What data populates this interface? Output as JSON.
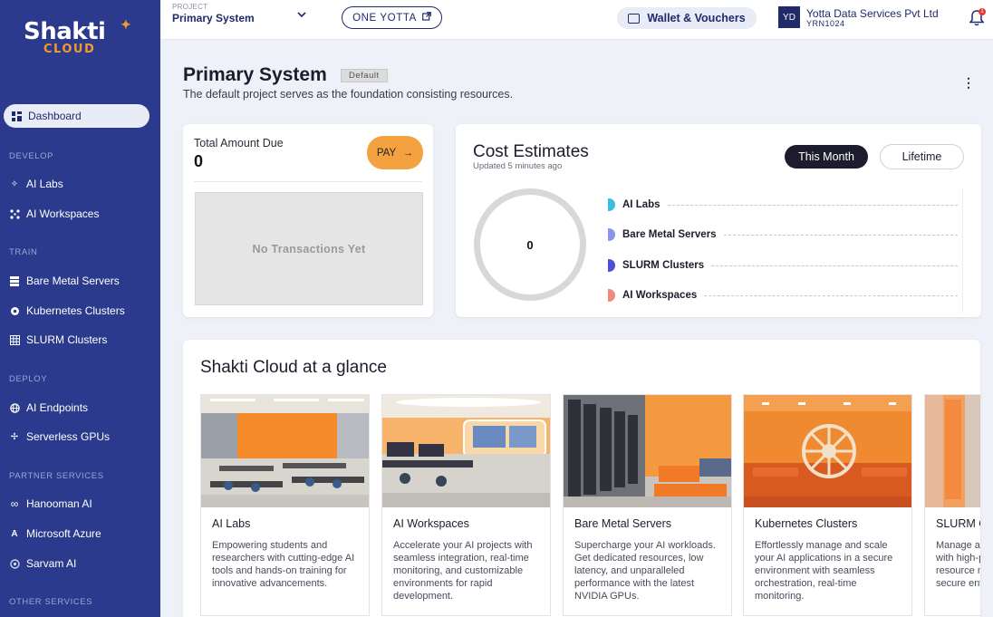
{
  "brand": {
    "name": "Shakti",
    "sub": "CLOUD"
  },
  "sidebar": {
    "active": {
      "label": "Dashboard"
    },
    "sections": [
      {
        "title": "DEVELOP",
        "items": [
          {
            "label": "AI Labs",
            "icon": "sparkle-icon"
          },
          {
            "label": "AI Workspaces",
            "icon": "nodes-icon"
          }
        ]
      },
      {
        "title": "TRAIN",
        "items": [
          {
            "label": "Bare Metal Servers",
            "icon": "server-icon"
          },
          {
            "label": "Kubernetes Clusters",
            "icon": "helm-icon"
          },
          {
            "label": "SLURM Clusters",
            "icon": "grid-icon"
          }
        ]
      },
      {
        "title": "DEPLOY",
        "items": [
          {
            "label": "AI Endpoints",
            "icon": "globe-icon"
          },
          {
            "label": "Serverless GPUs",
            "icon": "spark-cross-icon"
          }
        ]
      },
      {
        "title": "PARTNER SERVICES",
        "items": [
          {
            "label": "Hanooman AI",
            "icon": "infinity-icon"
          },
          {
            "label": "Microsoft Azure",
            "icon": "azure-icon"
          },
          {
            "label": "Sarvam AI",
            "icon": "sarvam-icon"
          }
        ]
      },
      {
        "title": "OTHER SERVICES",
        "items": []
      }
    ]
  },
  "topbar": {
    "project_label": "PROJECT",
    "project_name": "Primary System",
    "one_yotta": "ONE YOTTA",
    "wallet": "Wallet & Vouchers",
    "avatar": "YD",
    "org_name": "Yotta Data Services Pvt Ltd",
    "org_id": "YRN1024",
    "notif_count": "1"
  },
  "header": {
    "title": "Primary System",
    "badge": "Default",
    "subtitle": "The default project serves as the foundation consisting resources."
  },
  "amount": {
    "label": "Total Amount Due",
    "value": "0",
    "pay": "PAY",
    "empty": "No Transactions Yet"
  },
  "cost": {
    "title": "Cost Estimates",
    "updated": "Updated 5 minutes ago",
    "tab_month": "This Month",
    "tab_lifetime": "Lifetime",
    "total": "0",
    "legend": [
      {
        "label": "AI Labs",
        "color": "#35c0e0"
      },
      {
        "label": "Bare Metal Servers",
        "color": "#8b93f0"
      },
      {
        "label": "SLURM Clusters",
        "color": "#4a4fdc"
      },
      {
        "label": "AI Workspaces",
        "color": "#f08a80"
      }
    ]
  },
  "glance": {
    "title": "Shakti Cloud at a glance",
    "cards": [
      {
        "name": "AI Labs",
        "desc": "Empowering students and researchers with cutting-edge AI tools and hands-on training for innovative advancements."
      },
      {
        "name": "AI Workspaces",
        "desc": "Accelerate your AI projects with seamless integration, real-time monitoring, and customizable environments for rapid development."
      },
      {
        "name": "Bare Metal Servers",
        "desc": "Supercharge your AI workloads. Get dedicated resources, low latency, and unparalleled performance with the latest NVIDIA GPUs."
      },
      {
        "name": "Kubernetes Clusters",
        "desc": "Effortlessly manage and scale your AI applications in a secure environment with seamless orchestration, real-time monitoring."
      },
      {
        "name": "SLURM Clusters",
        "desc": "Manage and scale AI workloads with high-performance, efficient resource management, and secure environments."
      }
    ]
  }
}
